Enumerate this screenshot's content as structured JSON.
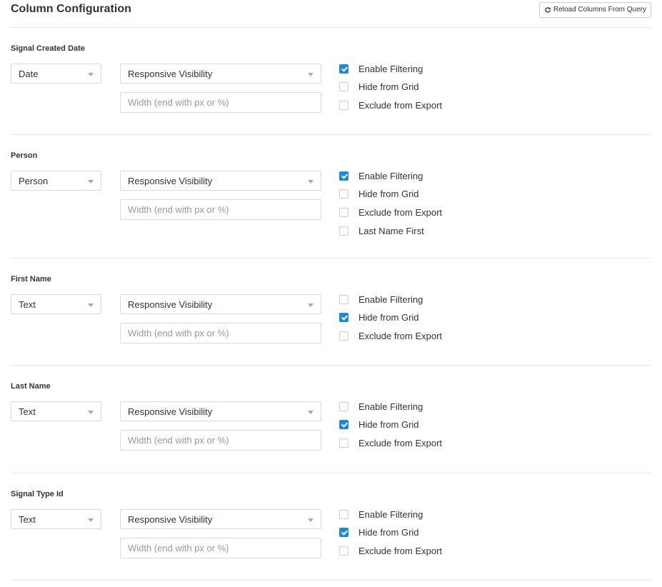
{
  "header": {
    "title": "Column Configuration",
    "reload_button": "Reload Columns From Query",
    "reload_icon": "refresh-icon"
  },
  "colors": {
    "accent": "#1a8bd6",
    "border": "#d9d9d9",
    "divider": "#e6e6e6"
  },
  "width_placeholder": "Width (end with px or %)",
  "columns": [
    {
      "label": "Signal Created Date",
      "type": "Date",
      "visibility": "Responsive Visibility",
      "width": "",
      "options": [
        {
          "label": "Enable Filtering",
          "checked": true
        },
        {
          "label": "Hide from Grid",
          "checked": false
        },
        {
          "label": "Exclude from Export",
          "checked": false
        }
      ]
    },
    {
      "label": "Person",
      "type": "Person",
      "visibility": "Responsive Visibility",
      "width": "",
      "options": [
        {
          "label": "Enable Filtering",
          "checked": true
        },
        {
          "label": "Hide from Grid",
          "checked": false
        },
        {
          "label": "Exclude from Export",
          "checked": false
        },
        {
          "label": "Last Name First",
          "checked": false
        }
      ]
    },
    {
      "label": "First Name",
      "type": "Text",
      "visibility": "Responsive Visibility",
      "width": "",
      "options": [
        {
          "label": "Enable Filtering",
          "checked": false
        },
        {
          "label": "Hide from Grid",
          "checked": true
        },
        {
          "label": "Exclude from Export",
          "checked": false
        }
      ]
    },
    {
      "label": "Last Name",
      "type": "Text",
      "visibility": "Responsive Visibility",
      "width": "",
      "options": [
        {
          "label": "Enable Filtering",
          "checked": false
        },
        {
          "label": "Hide from Grid",
          "checked": true
        },
        {
          "label": "Exclude from Export",
          "checked": false
        }
      ]
    },
    {
      "label": "Signal Type Id",
      "type": "Text",
      "visibility": "Responsive Visibility",
      "width": "",
      "options": [
        {
          "label": "Enable Filtering",
          "checked": false
        },
        {
          "label": "Hide from Grid",
          "checked": true
        },
        {
          "label": "Exclude from Export",
          "checked": false
        }
      ]
    }
  ]
}
